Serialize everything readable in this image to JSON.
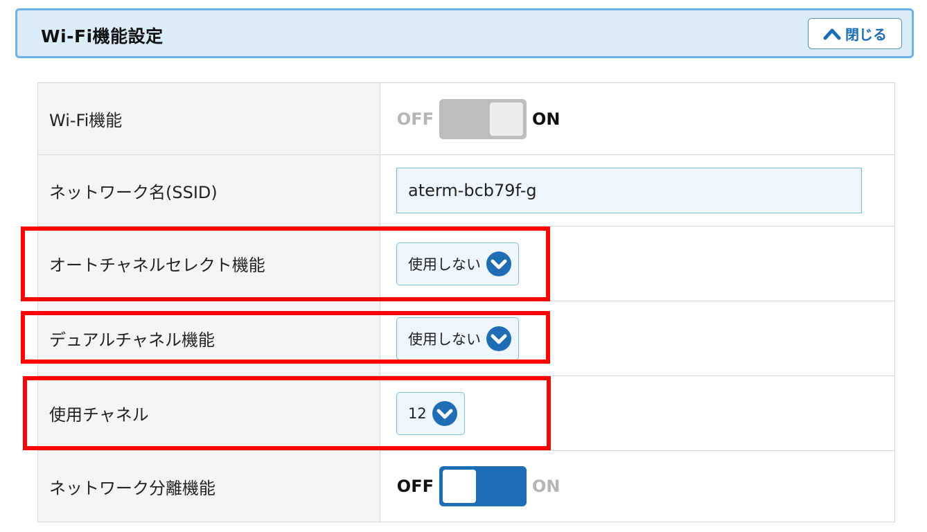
{
  "header": {
    "title": "Wi-Fi機能設定",
    "close_label": "閉じる"
  },
  "rows": {
    "wifi": {
      "label": "Wi-Fi機能",
      "off_label": "OFF",
      "on_label": "ON",
      "state": "ON"
    },
    "ssid": {
      "label": "ネットワーク名(SSID)",
      "value": "aterm-bcb79f-g"
    },
    "auto_channel": {
      "label": "オートチャネルセレクト機能",
      "value": "使用しない"
    },
    "dual_channel": {
      "label": "デュアルチャネル機能",
      "value": "使用しない"
    },
    "channel": {
      "label": "使用チャネル",
      "value": "12"
    },
    "separation": {
      "label": "ネットワーク分離機能",
      "off_label": "OFF",
      "on_label": "ON",
      "state": "OFF"
    }
  },
  "colors": {
    "accent": "#1f6db4",
    "header_bg": "#dcedfa",
    "highlight": "#ff0000"
  },
  "icons": {
    "close": "chevron-up-icon",
    "dropdown": "chevron-down-circle-icon"
  }
}
